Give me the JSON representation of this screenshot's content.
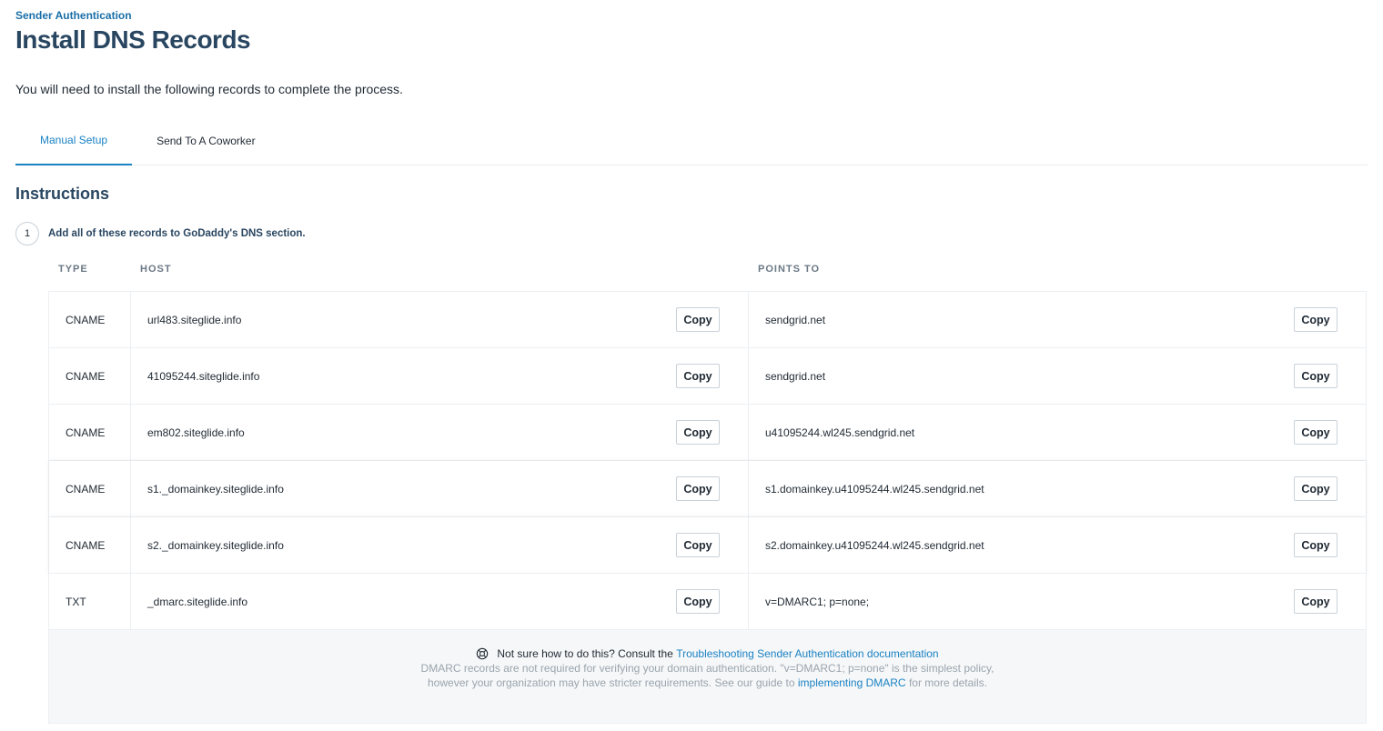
{
  "header": {
    "eyebrow": "Sender Authentication",
    "title": "Install DNS Records",
    "lead": "You will need to install the following records to complete the process."
  },
  "tabs": [
    {
      "label": "Manual Setup",
      "active": true
    },
    {
      "label": "Send To A Coworker",
      "active": false
    }
  ],
  "instructions": {
    "title": "Instructions",
    "step_number": "1",
    "step_text": "Add all of these records to GoDaddy's DNS section."
  },
  "table": {
    "headers": {
      "type": "TYPE",
      "host": "HOST",
      "points_to": "POINTS TO"
    },
    "copy_label": "Copy",
    "rows": [
      {
        "type": "CNAME",
        "host": "url483.siteglide.info",
        "points_to": "sendgrid.net"
      },
      {
        "type": "CNAME",
        "host": "41095244.siteglide.info",
        "points_to": "sendgrid.net"
      },
      {
        "type": "CNAME",
        "host": "em802.siteglide.info",
        "points_to": "u41095244.wl245.sendgrid.net"
      },
      {
        "type": "CNAME",
        "host": "s1._domainkey.siteglide.info",
        "points_to": "s1.domainkey.u41095244.wl245.sendgrid.net"
      },
      {
        "type": "CNAME",
        "host": "s2._domainkey.siteglide.info",
        "points_to": "s2.domainkey.u41095244.wl245.sendgrid.net"
      },
      {
        "type": "TXT",
        "host": "_dmarc.siteglide.info",
        "points_to": "v=DMARC1; p=none;"
      }
    ]
  },
  "footer": {
    "help_prefix": "Not sure how to do this? Consult the",
    "help_link": "Troubleshooting Sender Authentication documentation",
    "note_prefix": "DMARC records are not required for verifying your domain authentication. \"v=DMARC1; p=none\" is the simplest policy, however your organization may have stricter requirements. See our guide to",
    "note_link": "implementing DMARC",
    "note_suffix": "for more details."
  },
  "colors": {
    "accent": "#1a82c4",
    "heading": "#294661"
  }
}
